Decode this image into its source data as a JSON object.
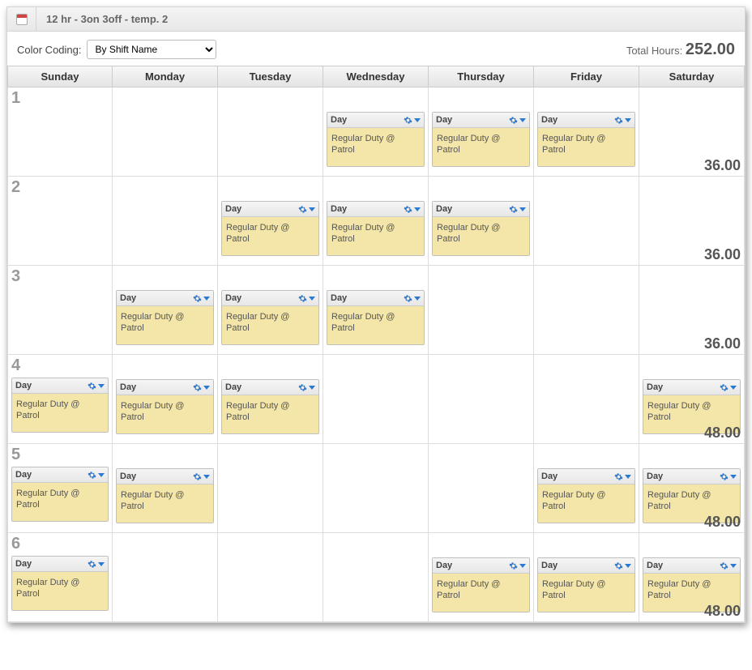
{
  "titlebar": {
    "title": "12 hr - 3on 3off - temp. 2"
  },
  "toolbar": {
    "color_coding_label": "Color Coding:",
    "color_coding_value": "By Shift Name",
    "total_hours_label": "Total Hours:",
    "total_hours_value": "252.00"
  },
  "days": [
    "Sunday",
    "Monday",
    "Tuesday",
    "Wednesday",
    "Thursday",
    "Friday",
    "Saturday"
  ],
  "shift_card": {
    "head_label": "Day",
    "body_text": "Regular Duty @ Patrol"
  },
  "weeks": [
    {
      "num": "1",
      "total": "36.00",
      "cells": [
        false,
        false,
        false,
        true,
        true,
        true,
        false
      ]
    },
    {
      "num": "2",
      "total": "36.00",
      "cells": [
        false,
        false,
        true,
        true,
        true,
        false,
        false
      ]
    },
    {
      "num": "3",
      "total": "36.00",
      "cells": [
        false,
        true,
        true,
        true,
        false,
        false,
        false
      ]
    },
    {
      "num": "4",
      "total": "48.00",
      "cells": [
        true,
        true,
        true,
        false,
        false,
        false,
        true
      ]
    },
    {
      "num": "5",
      "total": "48.00",
      "cells": [
        true,
        true,
        false,
        false,
        false,
        true,
        true
      ]
    },
    {
      "num": "6",
      "total": "48.00",
      "cells": [
        true,
        false,
        false,
        false,
        true,
        true,
        true
      ]
    }
  ]
}
